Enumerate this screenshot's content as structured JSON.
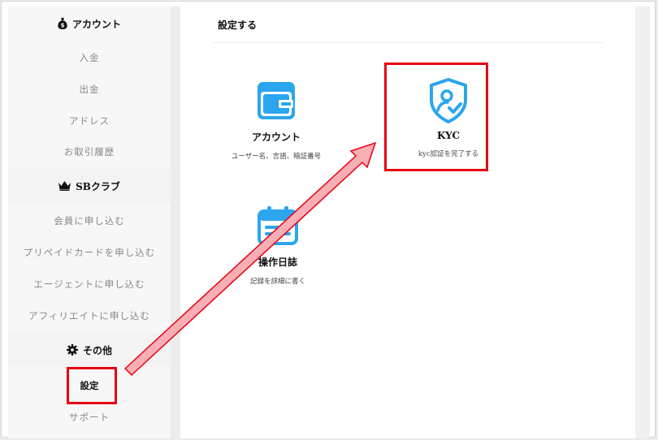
{
  "sidebar": {
    "account": {
      "header": "アカウント",
      "items": [
        "入金",
        "出金",
        "アドレス",
        "お取引履歴"
      ]
    },
    "sb_club": {
      "header": "SBクラブ",
      "items": [
        "会員に申し込む",
        "プリペイドカードを申し込む",
        "エージェントに申し込む",
        "アフィリエイトに申し込む"
      ]
    },
    "other": {
      "header": "その他",
      "items": [
        "設定",
        "サポート"
      ]
    }
  },
  "main": {
    "title": "設定する",
    "cards": [
      {
        "title": "アカウント",
        "desc": "ユーザー名、言語、暗証番号",
        "icon": "wallet-icon"
      },
      {
        "title": "KYC",
        "desc": "kyc認証を完了する",
        "icon": "shield-user-icon"
      },
      {
        "title": "操作日誌",
        "desc": "記録を詳細に書く",
        "icon": "calendar-icon"
      }
    ]
  },
  "colors": {
    "accent_blue": "#1e9be6",
    "highlight_red": "#e60012"
  }
}
